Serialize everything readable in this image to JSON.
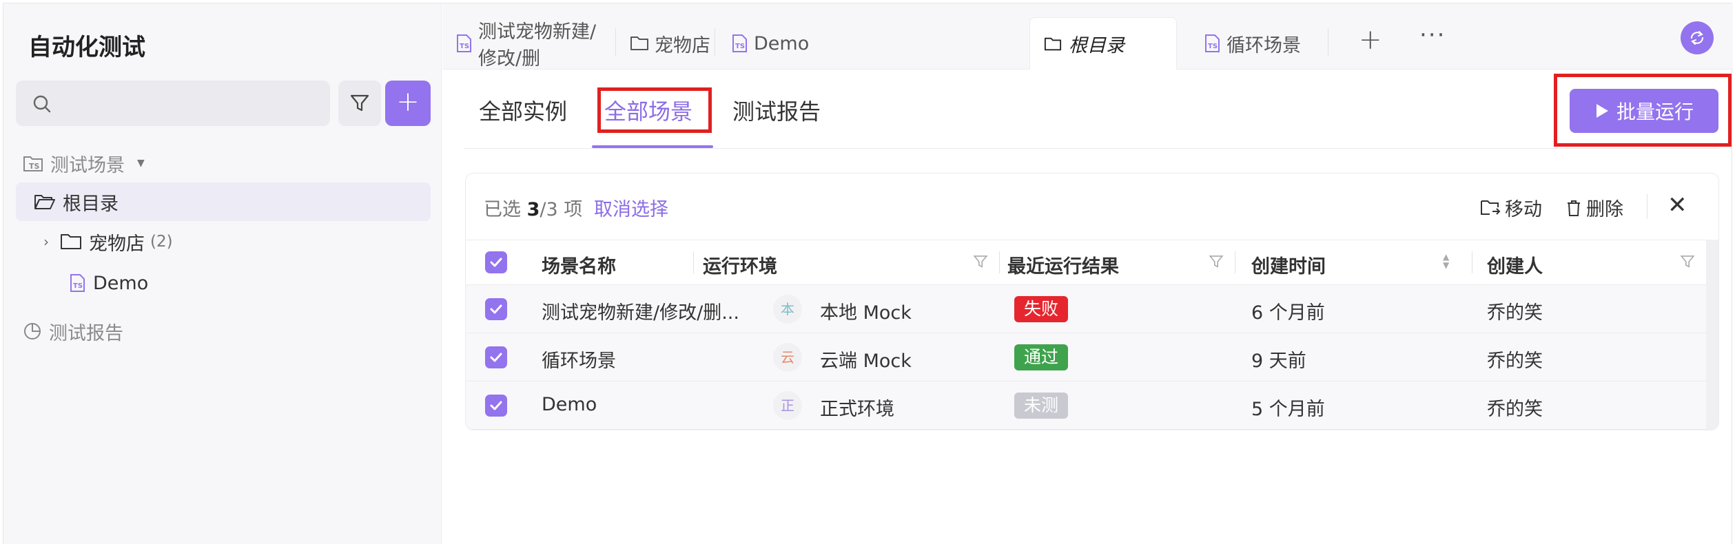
{
  "sidebar": {
    "title": "自动化测试",
    "tree": {
      "root_label": "测试场景",
      "root_dir": "根目录",
      "pet_store": "宠物店",
      "pet_store_count": "(2)",
      "demo": "Demo",
      "reports": "测试报告"
    }
  },
  "tabs": [
    {
      "label": "测试宠物新建/修改/删",
      "icon": "ts-file-icon"
    },
    {
      "label": "宠物店",
      "icon": "folder-icon"
    },
    {
      "label": "Demo",
      "icon": "ts-file-icon"
    },
    {
      "label": "根目录",
      "icon": "folder-icon",
      "active": true
    },
    {
      "label": "循环场景",
      "icon": "ts-file-icon"
    }
  ],
  "subtabs": [
    "全部实例",
    "全部场景",
    "测试报告"
  ],
  "active_subtab": "全部场景",
  "run_button": "批量运行",
  "selection": {
    "prefix": "已选 ",
    "selected": "3",
    "suffix": "/3 项",
    "cancel": "取消选择",
    "move": "移动",
    "delete": "删除"
  },
  "table": {
    "headers": [
      "场景名称",
      "运行环境",
      "最近运行结果",
      "创建时间",
      "创建人"
    ],
    "rows": [
      {
        "name": "测试宠物新建/修改/删...",
        "env_icon": "本",
        "env": "本地 Mock",
        "result": "失败",
        "time": "6 个月前",
        "creator": "乔的笑"
      },
      {
        "name": "循环场景",
        "env_icon": "云",
        "env": "云端 Mock",
        "result": "通过",
        "time": "9 天前",
        "creator": "乔的笑"
      },
      {
        "name": "Demo",
        "env_icon": "正",
        "env": "正式环境",
        "result": "未测",
        "time": "5 个月前",
        "creator": "乔的笑"
      }
    ]
  },
  "colors": {
    "accent": "#9373ee",
    "fail": "#e5262f",
    "pass": "#3fa34d",
    "untested": "#c9c9d1",
    "highlight": "#e02020"
  }
}
